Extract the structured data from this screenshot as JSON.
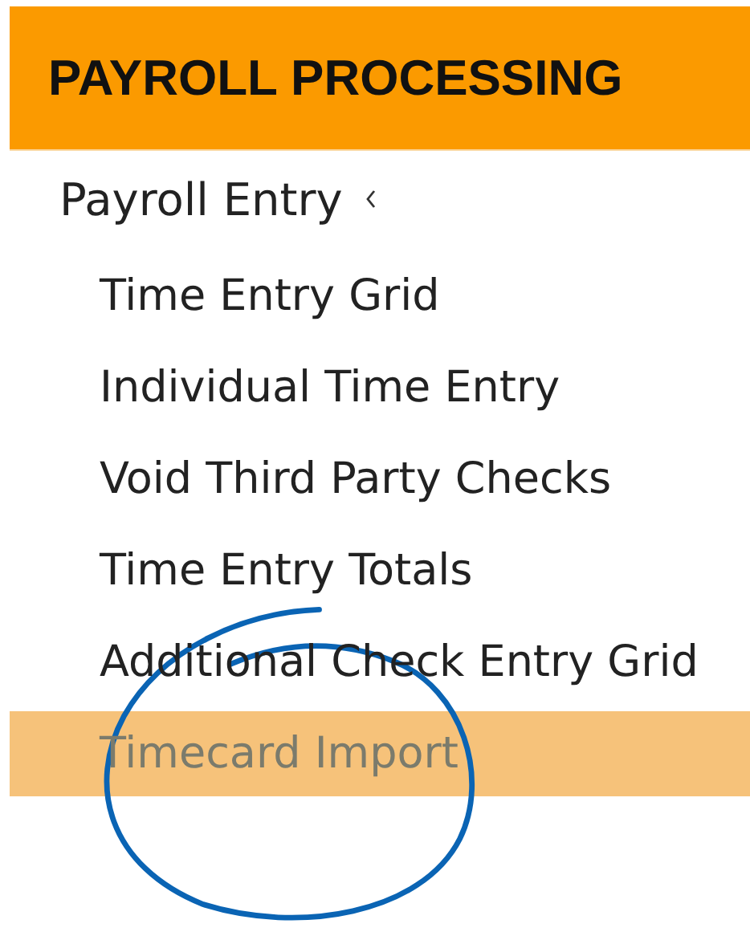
{
  "section_title": "PAYROLL PROCESSING",
  "menu": {
    "label": "Payroll Entry",
    "expanded": true,
    "children": [
      {
        "label": "Time Entry Grid",
        "selected": false
      },
      {
        "label": "Individual Time Entry",
        "selected": false
      },
      {
        "label": "Void Third Party Checks",
        "selected": false
      },
      {
        "label": "Time Entry Totals",
        "selected": false
      },
      {
        "label": "Additional Check Entry Grid",
        "selected": false
      },
      {
        "label": "Timecard Import",
        "selected": true
      }
    ]
  }
}
